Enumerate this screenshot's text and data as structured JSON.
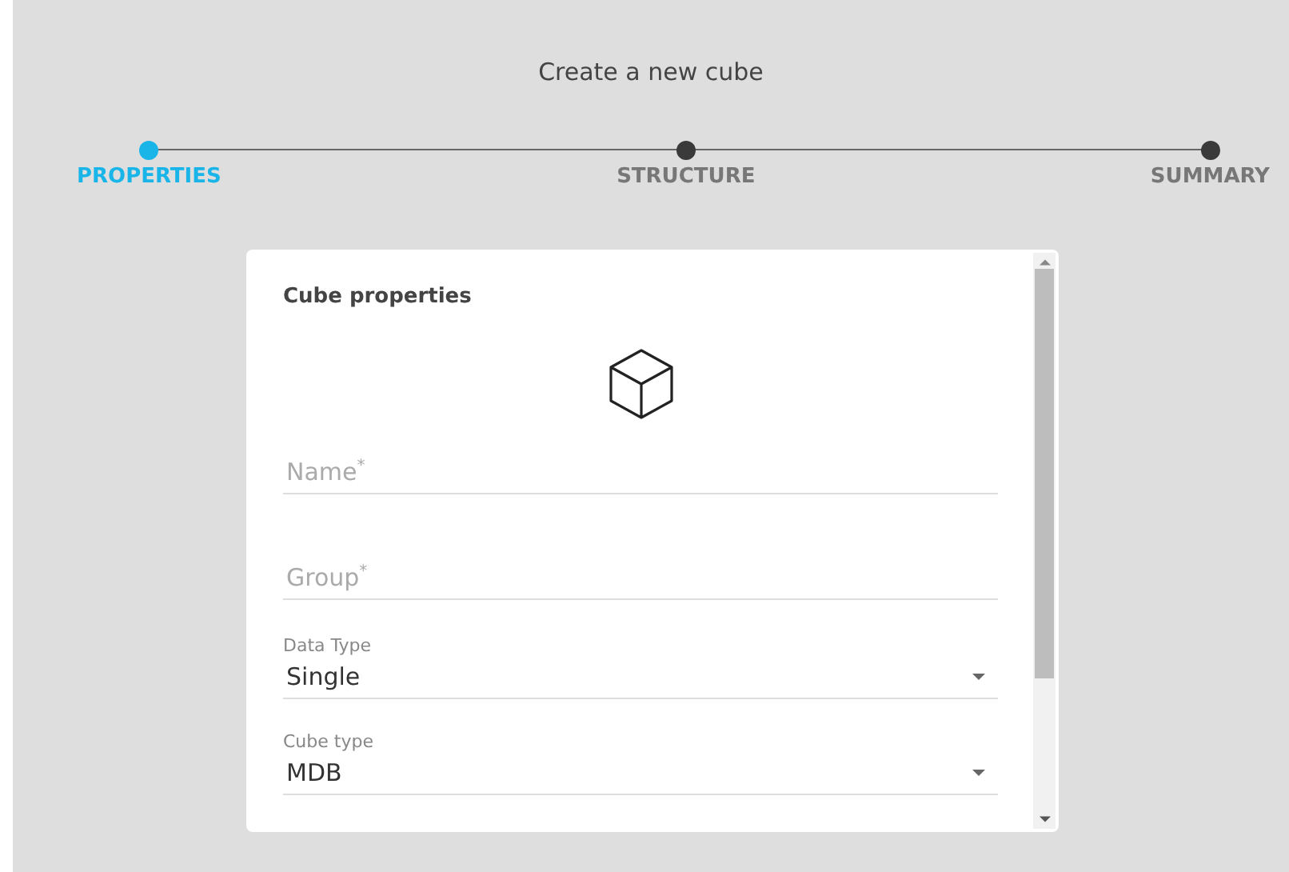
{
  "title": "Create a new cube",
  "steps": [
    {
      "label": "PROPERTIES",
      "selected": true
    },
    {
      "label": "STRUCTURE",
      "selected": false
    },
    {
      "label": "SUMMARY",
      "selected": false
    }
  ],
  "card": {
    "title": "Cube properties",
    "fields": [
      {
        "kind": "text",
        "placeholder": "Name$^{*}$"
      },
      {
        "kind": "text",
        "placeholder": "Group$^{*}$"
      },
      {
        "kind": "select",
        "label": "Data Type",
        "value": "Single"
      },
      {
        "kind": "select",
        "label": "Cube type",
        "value": "MDB"
      }
    ]
  }
}
